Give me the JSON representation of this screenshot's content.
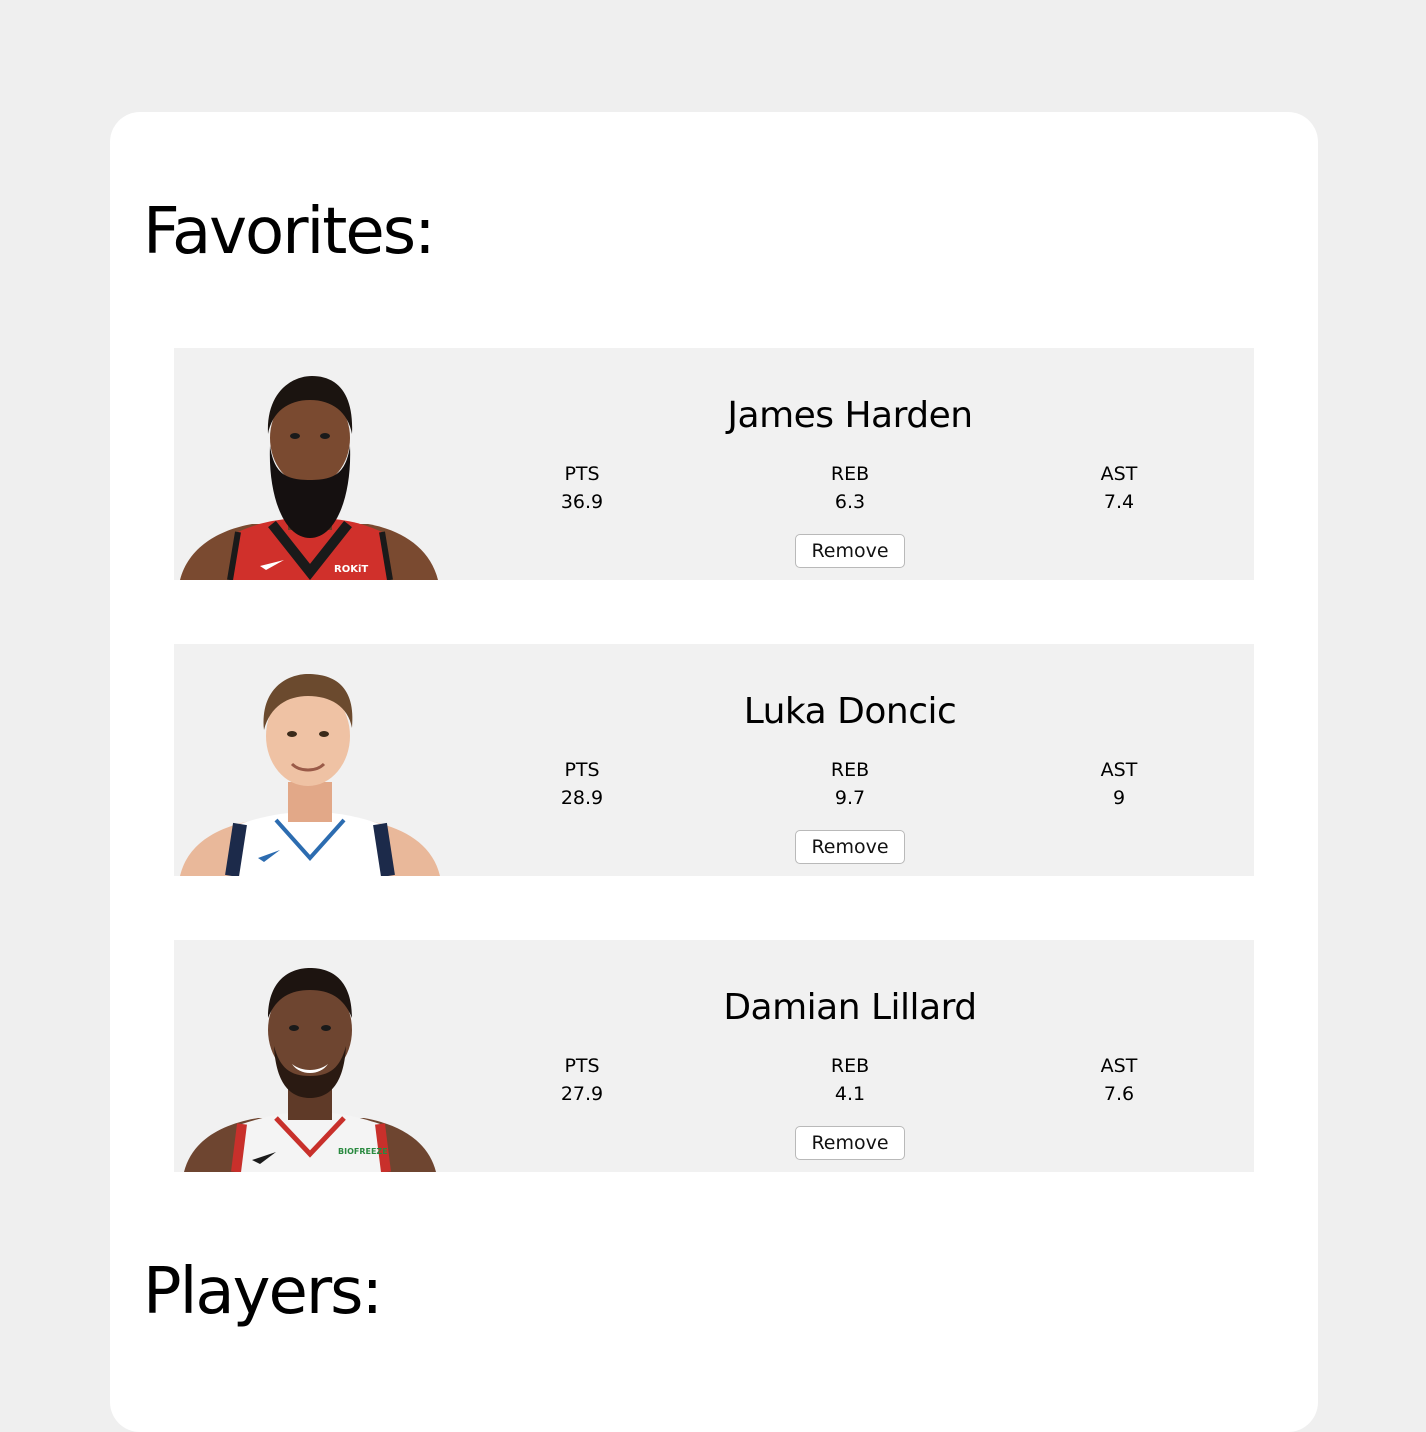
{
  "sections": {
    "favorites_title": "Favorites:",
    "players_title": "Players:"
  },
  "stat_labels": {
    "pts": "PTS",
    "reb": "REB",
    "ast": "AST"
  },
  "favorites": [
    {
      "name": "James Harden",
      "pts": "36.9",
      "reb": "6.3",
      "ast": "7.4",
      "remove_label": "Remove",
      "photo_icon": "player-headshot-harden"
    },
    {
      "name": "Luka Doncic",
      "pts": "28.9",
      "reb": "9.7",
      "ast": "9",
      "remove_label": "Remove",
      "photo_icon": "player-headshot-doncic"
    },
    {
      "name": "Damian Lillard",
      "pts": "27.9",
      "reb": "4.1",
      "ast": "7.6",
      "remove_label": "Remove",
      "photo_icon": "player-headshot-lillard"
    }
  ],
  "colors": {
    "page_bg": "#efefef",
    "panel_bg": "#ffffff",
    "card_bg": "#f1f1f1"
  }
}
